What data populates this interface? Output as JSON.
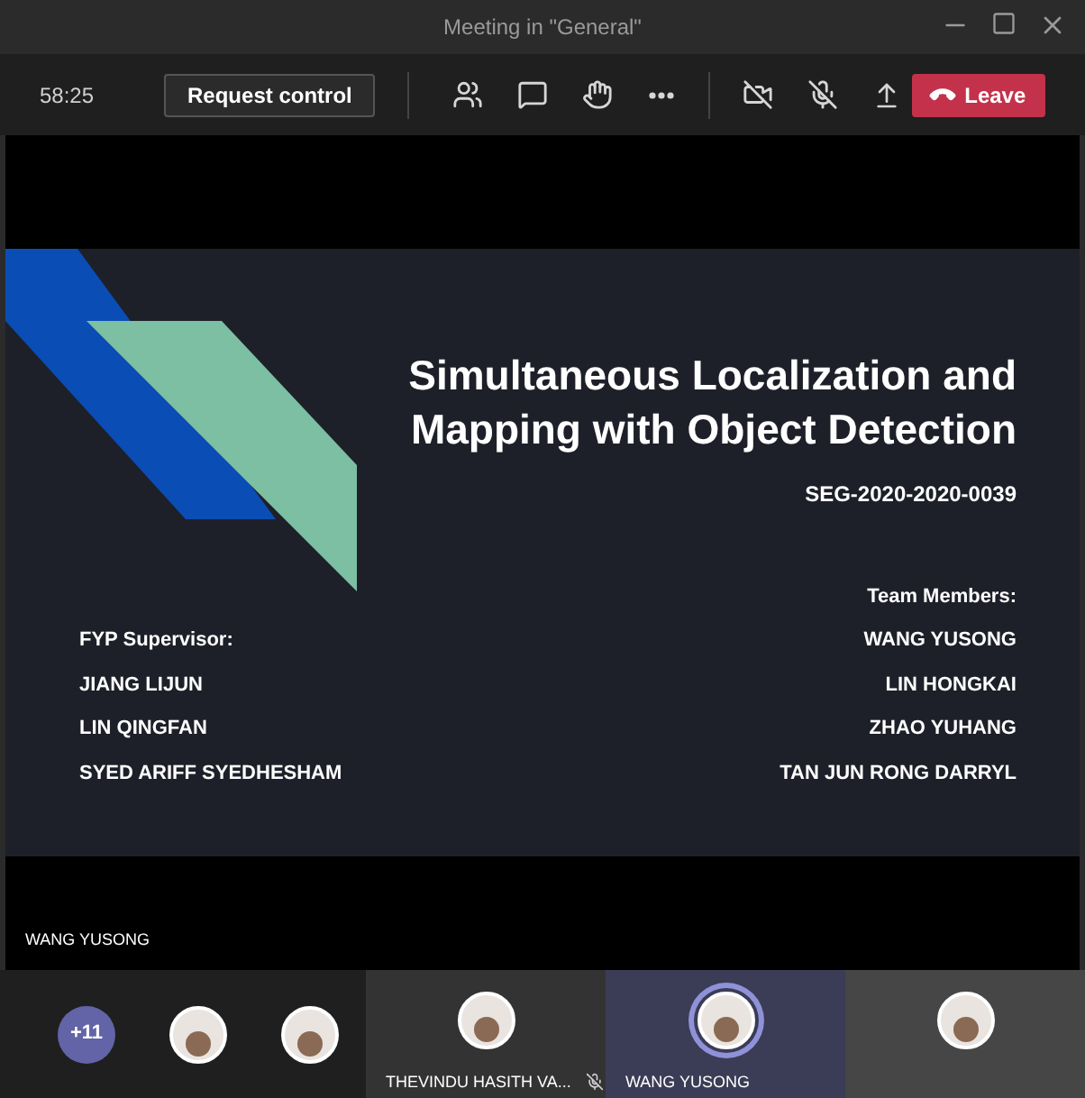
{
  "window": {
    "title": "Meeting in \"General\""
  },
  "toolbar": {
    "timer": "58:25",
    "request_control": "Request control",
    "leave": "Leave"
  },
  "slide": {
    "title_lines": [
      "Simultaneous Localization and",
      "Mapping with Object Detection"
    ],
    "code": "SEG-2020-2020-0039",
    "supervisor_heading": "FYP Supervisor:",
    "supervisors": [
      "JIANG LIJUN",
      "LIN QINGFAN",
      "SYED ARIFF SYEDHESHAM"
    ],
    "members_heading": "Team Members:",
    "members": [
      "WANG YUSONG",
      "LIN HONGKAI",
      "ZHAO YUHANG",
      "TAN JUN RONG DARRYL"
    ]
  },
  "presenter_label": "WANG YUSONG",
  "gallery": {
    "overflow_count": "+11",
    "tiles": [
      {
        "name": "THEVINDU HASITH VA...",
        "muted": true,
        "speaking": false
      },
      {
        "name": "WANG YUSONG",
        "muted": false,
        "speaking": true
      },
      {
        "speaking": false
      }
    ]
  }
}
